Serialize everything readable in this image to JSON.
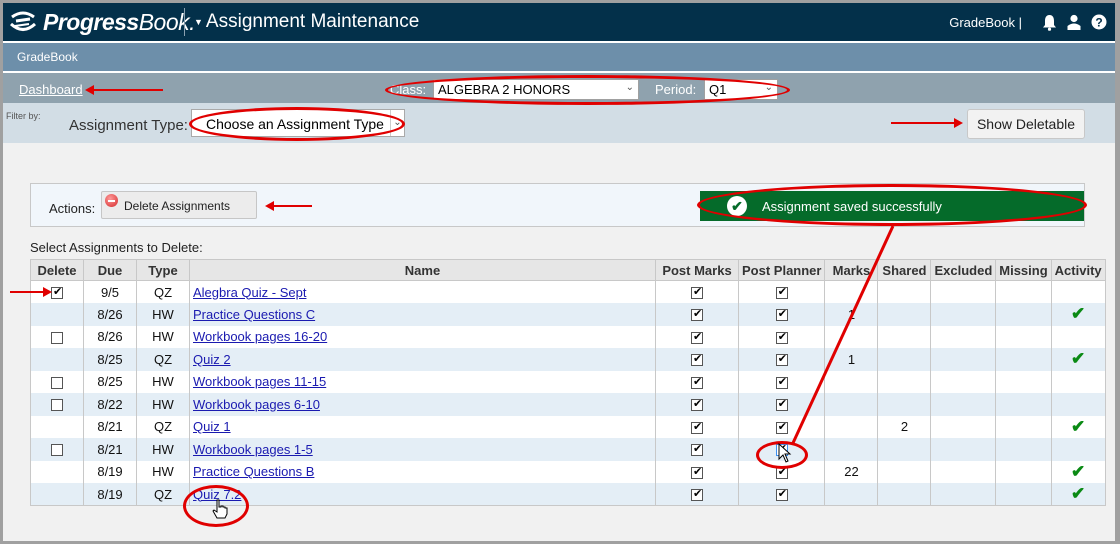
{
  "header": {
    "brand_bold": "Progress",
    "brand_thin": "Book.",
    "app_title": "Assignment Maintenance",
    "context_label": "GradeBook |",
    "icons": [
      "bell-icon",
      "user-icon",
      "help-icon"
    ]
  },
  "subheader": {
    "label": "GradeBook"
  },
  "nav": {
    "dashboard_link": "Dashboard",
    "class_label": "Class:",
    "class_value": "ALGEBRA 2 HONORS",
    "period_label": "Period:",
    "period_value": "Q1"
  },
  "filter": {
    "filter_by": "Filter by:",
    "assignment_type_label": "Assignment Type:",
    "assignment_type_value": "Choose an Assignment Type",
    "show_deletable": "Show Deletable"
  },
  "actions": {
    "label": "Actions:",
    "delete_button": "Delete Assignments",
    "success_message": "Assignment saved successfully"
  },
  "table": {
    "caption": "Select Assignments to Delete:",
    "columns": [
      "Delete",
      "Due",
      "Type",
      "Name",
      "Post Marks",
      "Post Planner",
      "Marks",
      "Shared",
      "Excluded",
      "Missing",
      "Activity"
    ],
    "rows": [
      {
        "delete": "checked",
        "due": "9/5",
        "type": "QZ",
        "name": "Alegbra Quiz - Sept",
        "post_marks": true,
        "post_planner": true,
        "marks": "",
        "shared": "",
        "excluded": "",
        "missing": "",
        "activity": false
      },
      {
        "delete": "none",
        "due": "8/26",
        "type": "HW",
        "name": "Practice Questions C",
        "post_marks": true,
        "post_planner": true,
        "marks": "1",
        "shared": "",
        "excluded": "",
        "missing": "",
        "activity": true
      },
      {
        "delete": "unchecked",
        "due": "8/26",
        "type": "HW",
        "name": "Workbook pages 16-20",
        "post_marks": true,
        "post_planner": true,
        "marks": "",
        "shared": "",
        "excluded": "",
        "missing": "",
        "activity": false
      },
      {
        "delete": "none",
        "due": "8/25",
        "type": "QZ",
        "name": "Quiz 2",
        "post_marks": true,
        "post_planner": true,
        "marks": "1",
        "shared": "",
        "excluded": "",
        "missing": "",
        "activity": true
      },
      {
        "delete": "unchecked",
        "due": "8/25",
        "type": "HW",
        "name": "Workbook pages 11-15",
        "post_marks": true,
        "post_planner": true,
        "marks": "",
        "shared": "",
        "excluded": "",
        "missing": "",
        "activity": false
      },
      {
        "delete": "unchecked",
        "due": "8/22",
        "type": "HW",
        "name": "Workbook pages 6-10",
        "post_marks": true,
        "post_planner": true,
        "marks": "",
        "shared": "",
        "excluded": "",
        "missing": "",
        "activity": false
      },
      {
        "delete": "none",
        "due": "8/21",
        "type": "QZ",
        "name": "Quiz 1",
        "post_marks": true,
        "post_planner": true,
        "marks": "",
        "shared": "2",
        "excluded": "",
        "missing": "",
        "activity": true
      },
      {
        "delete": "unchecked",
        "due": "8/21",
        "type": "HW",
        "name": "Workbook pages 1-5",
        "post_marks": true,
        "post_planner": true,
        "marks": "",
        "shared": "",
        "excluded": "",
        "missing": "",
        "activity": false
      },
      {
        "delete": "none",
        "due": "8/19",
        "type": "HW",
        "name": "Practice Questions B",
        "post_marks": true,
        "post_planner": true,
        "marks": "22",
        "shared": "",
        "excluded": "",
        "missing": "",
        "activity": true
      },
      {
        "delete": "none",
        "due": "8/19",
        "type": "QZ",
        "name": "Quiz 7.2",
        "post_marks": true,
        "post_planner": true,
        "marks": "",
        "shared": "",
        "excluded": "",
        "missing": "",
        "activity": true
      }
    ]
  },
  "colors": {
    "topbar": "#03304a",
    "subheader": "#6d8faa",
    "success": "#056b2a",
    "annotation": "#e00000",
    "link": "#1a1ab0",
    "activity_check": "#0a8a14"
  }
}
